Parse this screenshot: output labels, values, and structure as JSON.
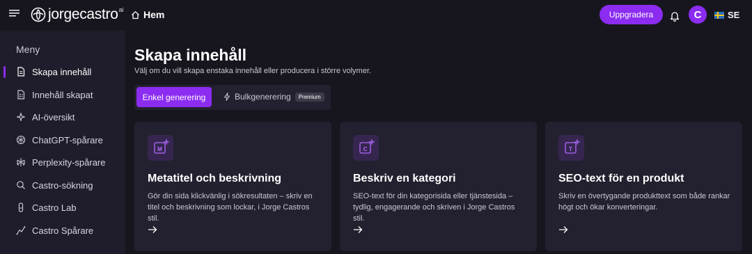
{
  "header": {
    "logo_text": "jorgecastro",
    "logo_sup": "ai",
    "home_label": "Hem",
    "upgrade_label": "Uppgradera",
    "avatar_initial": "C",
    "language": "SE",
    "accent_color": "#8b2cf0"
  },
  "sidebar": {
    "title": "Meny",
    "items": [
      {
        "label": "Skapa innehåll",
        "icon": "document-icon",
        "active": true
      },
      {
        "label": "Innehåll skapat",
        "icon": "file-list-icon",
        "active": false
      },
      {
        "label": "AI-översikt",
        "icon": "sparkle-icon",
        "active": false
      },
      {
        "label": "ChatGPT-spårare",
        "icon": "chatgpt-icon",
        "active": false
      },
      {
        "label": "Perplexity-spårare",
        "icon": "perplexity-icon",
        "active": false
      },
      {
        "label": "Castro-sökning",
        "icon": "search-icon",
        "active": false
      },
      {
        "label": "Castro Lab",
        "icon": "flask-icon",
        "active": false
      },
      {
        "label": "Castro Spårare",
        "icon": "line-chart-icon",
        "active": false
      }
    ]
  },
  "main": {
    "title": "Skapa innehåll",
    "subtitle": "Välj om du vill skapa enstaka innehåll eller producera i större volymer.",
    "tabs": {
      "simple": "Enkel generering",
      "bulk": "Bulkgenerering",
      "bulk_badge": "Premium"
    },
    "cards": [
      {
        "letter": "M",
        "title": "Metatitel och beskrivning",
        "description": "Gör din sida klickvänlig i sökresultaten – skriv en titel och beskrivning som lockar, i Jorge Castros stil."
      },
      {
        "letter": "C",
        "title": "Beskriv en kategori",
        "description": "SEO-text för din kategorisida eller tjänstesida – tydlig, engagerande och skriven i Jorge Castros stil."
      },
      {
        "letter": "T",
        "title": "SEO-text för en produkt",
        "description": "Skriv en övertygande produkttext som både rankar högt och ökar konverteringar."
      }
    ]
  }
}
